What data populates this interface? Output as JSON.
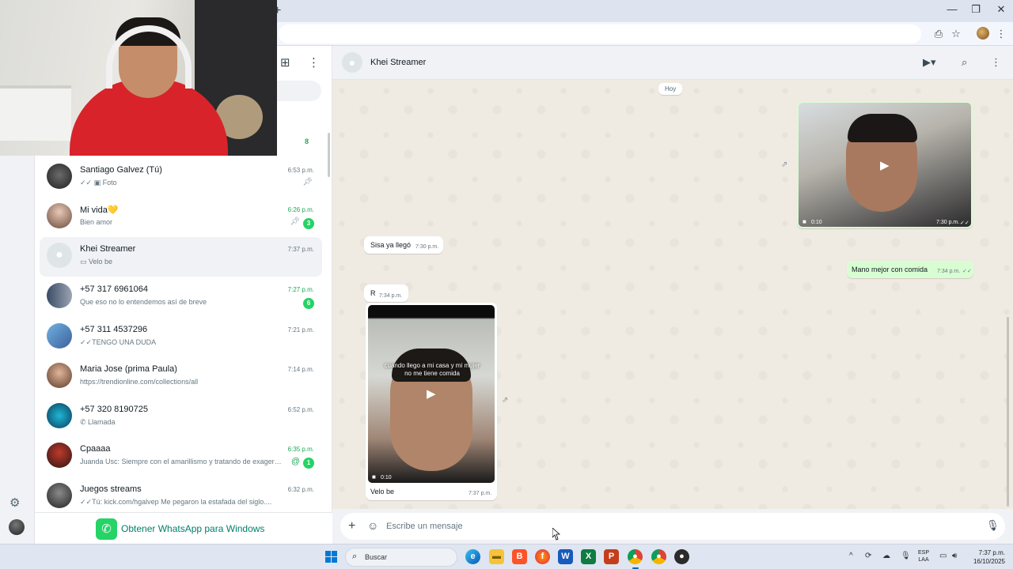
{
  "browser": {
    "new_tab_icon": "+",
    "window_controls": [
      "—",
      "❐",
      "✕"
    ]
  },
  "sidebar": {
    "unread_count": "8",
    "settings_icon": "gear-icon"
  },
  "chats": [
    {
      "name": "Santiago Galvez (Tú)",
      "preview": "✓✓ ▣ Foto",
      "time": "6:53 p.m.",
      "pinned": true
    },
    {
      "name": "Mi vida💛",
      "preview": "Bien amor",
      "time": "6:26 p.m.",
      "pinned": true,
      "unread": "3"
    },
    {
      "name": "Khei Streamer",
      "preview": "▭ Velo be",
      "time": "7:37 p.m.",
      "active": true
    },
    {
      "name": "+57 317 6961064",
      "preview": "Que eso no lo entendemos así de breve",
      "time": "7:27 p.m.",
      "unread": "6"
    },
    {
      "name": "+57 311 4537296",
      "preview": "✓✓TENGO UNA DUDA",
      "time": "7:21 p.m."
    },
    {
      "name": "Maria Jose (prima Paula)",
      "preview": "https://trendionline.com/collections/all",
      "time": "7:14 p.m."
    },
    {
      "name": "+57 320 8190725",
      "preview": "✆ Llamada",
      "time": "6:52 p.m."
    },
    {
      "name": "Cpaaaa",
      "preview": "Juanda Usc: Siempre con el amarillismo y tratando de exager…",
      "time": "6:35 p.m.",
      "unread": "1",
      "mention": true
    },
    {
      "name": "Juegos streams",
      "preview": "✓✓Tú: kick.com/hgalvep Me pegaron la estafada del siglo....",
      "time": "6:32 p.m."
    }
  ],
  "get_app": {
    "label": "Obtener WhatsApp para Windows"
  },
  "conversation": {
    "contact_name": "Khei Streamer",
    "date_chip": "Hoy",
    "messages": {
      "video_out_1": {
        "duration": "0:10",
        "time": "7:30 p.m.",
        "ticks": "✓✓"
      },
      "text_in_1": {
        "text": "Sisa ya llegó",
        "time": "7:30 p.m."
      },
      "text_out_1": {
        "text": "Mano mejor con comida",
        "time": "7:34 p.m.",
        "ticks": "✓✓"
      },
      "text_in_2": {
        "text": "R",
        "time": "7:34 p.m."
      },
      "video_in_1": {
        "overlay": "cuando llego a mi casa y mi mujer no me tiene comida",
        "duration": "0:10",
        "caption": "Velo be",
        "time": "7:37 p.m."
      }
    },
    "composer": {
      "placeholder": "Escribe un mensaje"
    }
  },
  "taskbar": {
    "search_label": "Buscar",
    "lang_top": "ESP",
    "lang_bottom": "LAA",
    "clock_time": "7:37 p.m.",
    "clock_date": "16/10/2025"
  },
  "colors": {
    "whatsapp_green": "#25d366",
    "outgoing_bubble": "#d9fdd3",
    "chat_background": "#efeae2",
    "accent_teal": "#008069"
  }
}
